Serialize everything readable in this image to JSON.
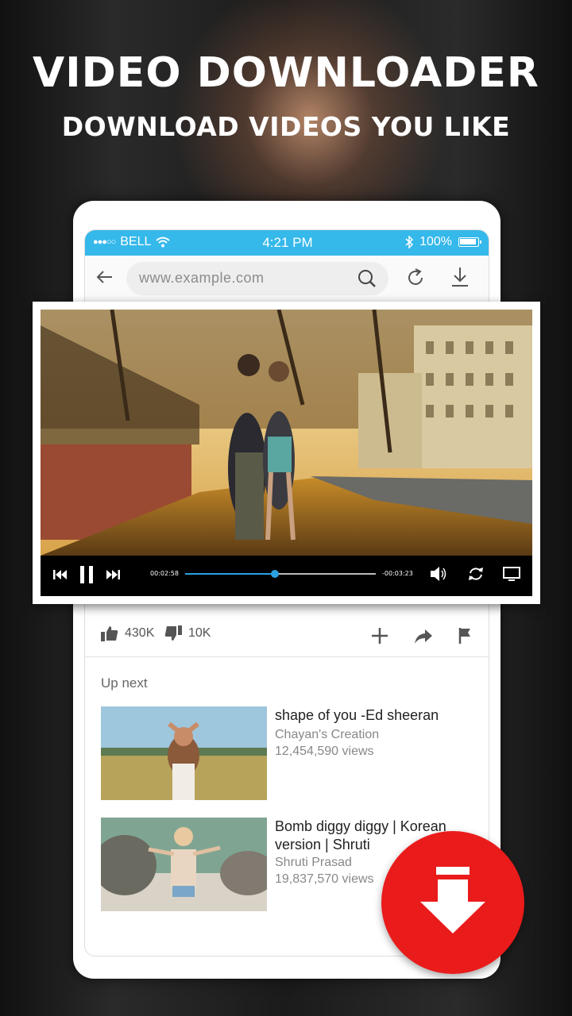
{
  "promo": {
    "headline": "VIDEO DOWNLOADER",
    "subheadline": "DOWNLOAD VIDEOS YOU LIKE"
  },
  "status_bar": {
    "carrier": "BELL",
    "signal_dots": "●●●○○",
    "time": "4:21 PM",
    "battery": "100%",
    "color": "#35b8ea"
  },
  "browser": {
    "url": "www.example.com"
  },
  "player": {
    "elapsed": "00:02:58",
    "remaining": "-00:03:23",
    "progress": 0.47,
    "accent": "#2aa0e0"
  },
  "actions": {
    "likes": "430K",
    "dislikes": "10K"
  },
  "up_next": {
    "heading": "Up next",
    "items": [
      {
        "title": "shape of you -Ed sheeran",
        "channel": "Chayan's Creation",
        "views": "12,454,590 views"
      },
      {
        "title": "Bomb diggy diggy | Korean version | Shruti",
        "channel": "Shruti Prasad",
        "views": "19,837,570 views"
      }
    ]
  },
  "fab": {
    "color": "#ea1b1b",
    "icon": "download-icon"
  }
}
